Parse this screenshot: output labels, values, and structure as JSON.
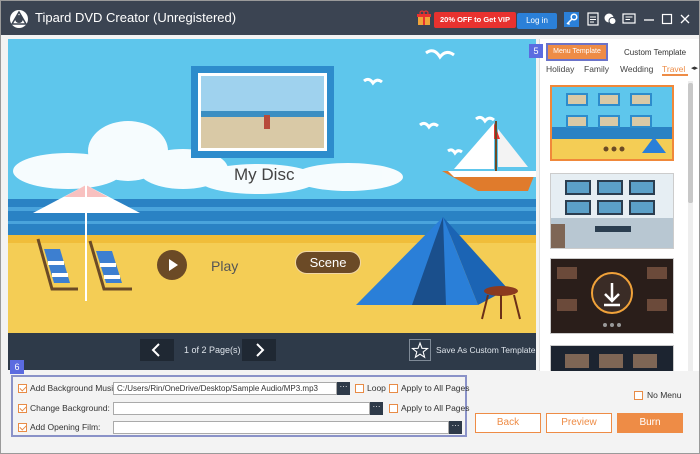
{
  "app": {
    "title": "Tipard DVD Creator (Unregistered)",
    "promo_label": "20% OFF to Get VIP",
    "login_label": "Log in"
  },
  "preview": {
    "disc_title": "My Disc",
    "play_label": "Play",
    "scene_label": "Scene"
  },
  "pager": {
    "page_info": "1 of 2 Page(s)",
    "save_template_label": "Save As Custom Template"
  },
  "right_panel": {
    "callout_number": "5",
    "tab_menu_template": "Menu Template",
    "tab_custom_template": "Custom Template",
    "categories": [
      "Holiday",
      "Family",
      "Wedding",
      "Travel"
    ],
    "selected_category": "Travel"
  },
  "bottom": {
    "callout_number": "6",
    "background_music": {
      "label": "Add Background Music:",
      "value": "C:/Users/Rin/OneDrive/Desktop/Sample Audio/MP3.mp3",
      "checked": true,
      "loop_label": "Loop",
      "apply_label": "Apply to All Pages"
    },
    "background": {
      "label": "Change Background:",
      "value": "",
      "checked": true,
      "apply_label": "Apply to All Pages"
    },
    "opening_film": {
      "label": "Add Opening Film:",
      "value": "",
      "checked": true
    },
    "browse_label": "···",
    "no_menu_label": "No Menu",
    "back_label": "Back",
    "preview_label": "Preview",
    "burn_label": "Burn"
  },
  "colors": {
    "titlebar": "#3b4452",
    "accent_orange": "#ee8c46",
    "callout": "#5b6be0",
    "sky": "#5ec6ec",
    "sea": "#2a82c4",
    "sand": "#f4cd55"
  }
}
